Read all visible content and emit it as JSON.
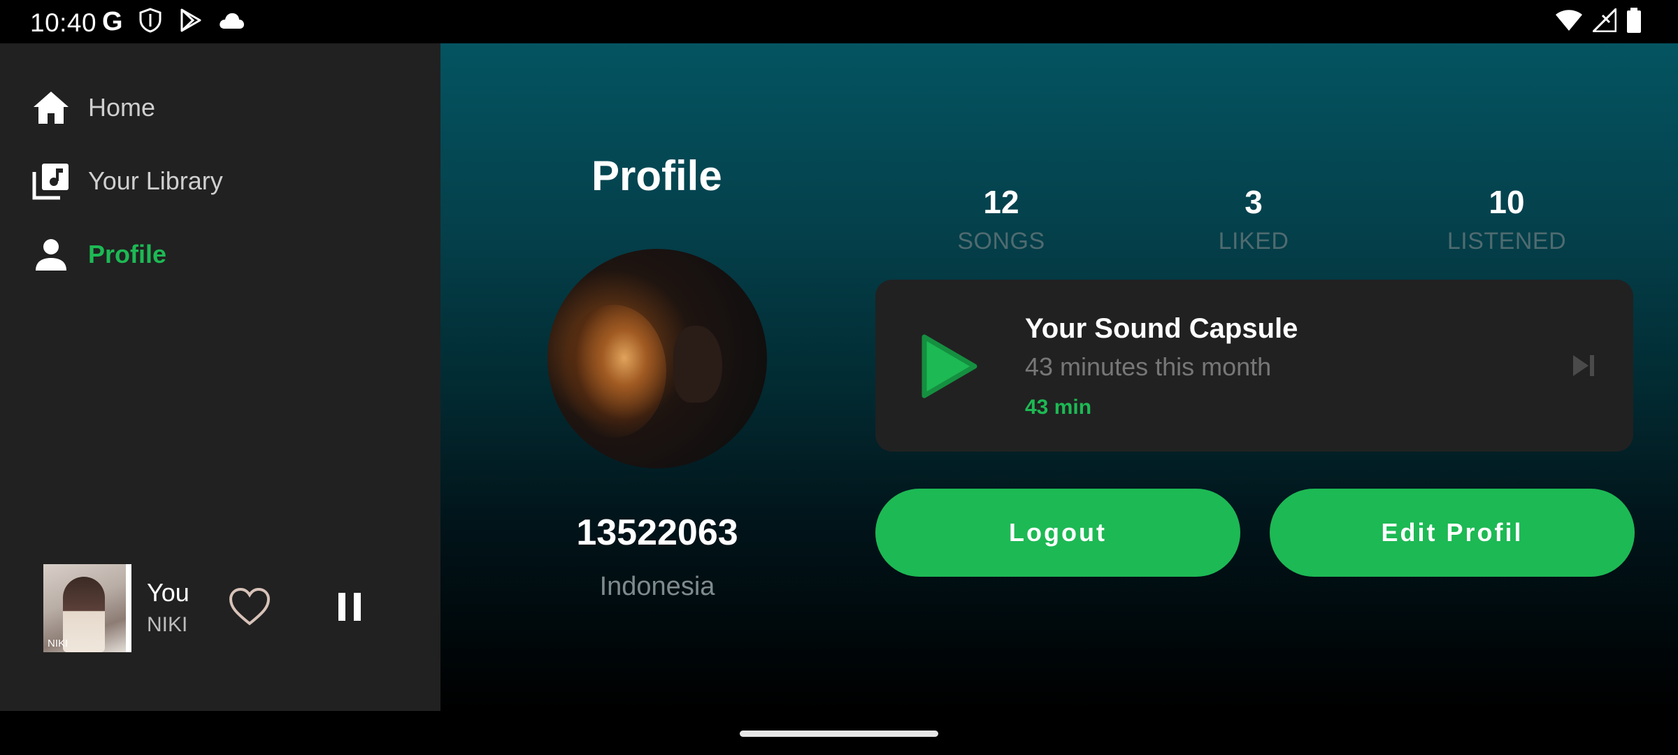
{
  "status_bar": {
    "time": "10:40",
    "left_icons": [
      "google-icon",
      "shield-icon",
      "play-store-icon",
      "cloud-icon"
    ],
    "right_icons": [
      "wifi-icon",
      "signal-icon",
      "battery-icon"
    ]
  },
  "sidebar": {
    "items": [
      {
        "label": "Home",
        "icon": "home-icon",
        "active": false
      },
      {
        "label": "Your Library",
        "icon": "library-icon",
        "active": false
      },
      {
        "label": "Profile",
        "icon": "person-icon",
        "active": true
      }
    ]
  },
  "now_playing": {
    "title": "You",
    "artist": "NIKI",
    "album_art_text": "NIKI",
    "liked": false,
    "state": "playing"
  },
  "profile": {
    "title": "Profile",
    "username": "13522063",
    "country": "Indonesia",
    "stats": [
      {
        "value": "12",
        "label": "SONGS"
      },
      {
        "value": "3",
        "label": "LIKED"
      },
      {
        "value": "10",
        "label": "LISTENED"
      }
    ]
  },
  "sound_capsule": {
    "title": "Your Sound Capsule",
    "subtitle": "43 minutes this month",
    "duration": "43 min"
  },
  "actions": {
    "logout_label": "Logout",
    "edit_label": "Edit Profil"
  },
  "colors": {
    "accent": "#1db954",
    "sidebar_bg": "#212121",
    "main_gradient_top": "#045461",
    "card_bg": "#212121"
  }
}
